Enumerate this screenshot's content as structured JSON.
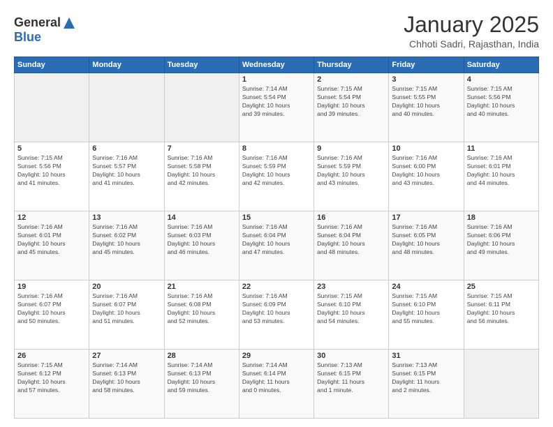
{
  "logo": {
    "general": "General",
    "blue": "Blue"
  },
  "header": {
    "month": "January 2025",
    "location": "Chhoti Sadri, Rajasthan, India"
  },
  "weekdays": [
    "Sunday",
    "Monday",
    "Tuesday",
    "Wednesday",
    "Thursday",
    "Friday",
    "Saturday"
  ],
  "weeks": [
    [
      {
        "day": "",
        "info": ""
      },
      {
        "day": "",
        "info": ""
      },
      {
        "day": "",
        "info": ""
      },
      {
        "day": "1",
        "info": "Sunrise: 7:14 AM\nSunset: 5:54 PM\nDaylight: 10 hours\nand 39 minutes."
      },
      {
        "day": "2",
        "info": "Sunrise: 7:15 AM\nSunset: 5:54 PM\nDaylight: 10 hours\nand 39 minutes."
      },
      {
        "day": "3",
        "info": "Sunrise: 7:15 AM\nSunset: 5:55 PM\nDaylight: 10 hours\nand 40 minutes."
      },
      {
        "day": "4",
        "info": "Sunrise: 7:15 AM\nSunset: 5:56 PM\nDaylight: 10 hours\nand 40 minutes."
      }
    ],
    [
      {
        "day": "5",
        "info": "Sunrise: 7:15 AM\nSunset: 5:56 PM\nDaylight: 10 hours\nand 41 minutes."
      },
      {
        "day": "6",
        "info": "Sunrise: 7:16 AM\nSunset: 5:57 PM\nDaylight: 10 hours\nand 41 minutes."
      },
      {
        "day": "7",
        "info": "Sunrise: 7:16 AM\nSunset: 5:58 PM\nDaylight: 10 hours\nand 42 minutes."
      },
      {
        "day": "8",
        "info": "Sunrise: 7:16 AM\nSunset: 5:59 PM\nDaylight: 10 hours\nand 42 minutes."
      },
      {
        "day": "9",
        "info": "Sunrise: 7:16 AM\nSunset: 5:59 PM\nDaylight: 10 hours\nand 43 minutes."
      },
      {
        "day": "10",
        "info": "Sunrise: 7:16 AM\nSunset: 6:00 PM\nDaylight: 10 hours\nand 43 minutes."
      },
      {
        "day": "11",
        "info": "Sunrise: 7:16 AM\nSunset: 6:01 PM\nDaylight: 10 hours\nand 44 minutes."
      }
    ],
    [
      {
        "day": "12",
        "info": "Sunrise: 7:16 AM\nSunset: 6:01 PM\nDaylight: 10 hours\nand 45 minutes."
      },
      {
        "day": "13",
        "info": "Sunrise: 7:16 AM\nSunset: 6:02 PM\nDaylight: 10 hours\nand 45 minutes."
      },
      {
        "day": "14",
        "info": "Sunrise: 7:16 AM\nSunset: 6:03 PM\nDaylight: 10 hours\nand 46 minutes."
      },
      {
        "day": "15",
        "info": "Sunrise: 7:16 AM\nSunset: 6:04 PM\nDaylight: 10 hours\nand 47 minutes."
      },
      {
        "day": "16",
        "info": "Sunrise: 7:16 AM\nSunset: 6:04 PM\nDaylight: 10 hours\nand 48 minutes."
      },
      {
        "day": "17",
        "info": "Sunrise: 7:16 AM\nSunset: 6:05 PM\nDaylight: 10 hours\nand 48 minutes."
      },
      {
        "day": "18",
        "info": "Sunrise: 7:16 AM\nSunset: 6:06 PM\nDaylight: 10 hours\nand 49 minutes."
      }
    ],
    [
      {
        "day": "19",
        "info": "Sunrise: 7:16 AM\nSunset: 6:07 PM\nDaylight: 10 hours\nand 50 minutes."
      },
      {
        "day": "20",
        "info": "Sunrise: 7:16 AM\nSunset: 6:07 PM\nDaylight: 10 hours\nand 51 minutes."
      },
      {
        "day": "21",
        "info": "Sunrise: 7:16 AM\nSunset: 6:08 PM\nDaylight: 10 hours\nand 52 minutes."
      },
      {
        "day": "22",
        "info": "Sunrise: 7:16 AM\nSunset: 6:09 PM\nDaylight: 10 hours\nand 53 minutes."
      },
      {
        "day": "23",
        "info": "Sunrise: 7:15 AM\nSunset: 6:10 PM\nDaylight: 10 hours\nand 54 minutes."
      },
      {
        "day": "24",
        "info": "Sunrise: 7:15 AM\nSunset: 6:10 PM\nDaylight: 10 hours\nand 55 minutes."
      },
      {
        "day": "25",
        "info": "Sunrise: 7:15 AM\nSunset: 6:11 PM\nDaylight: 10 hours\nand 56 minutes."
      }
    ],
    [
      {
        "day": "26",
        "info": "Sunrise: 7:15 AM\nSunset: 6:12 PM\nDaylight: 10 hours\nand 57 minutes."
      },
      {
        "day": "27",
        "info": "Sunrise: 7:14 AM\nSunset: 6:13 PM\nDaylight: 10 hours\nand 58 minutes."
      },
      {
        "day": "28",
        "info": "Sunrise: 7:14 AM\nSunset: 6:13 PM\nDaylight: 10 hours\nand 59 minutes."
      },
      {
        "day": "29",
        "info": "Sunrise: 7:14 AM\nSunset: 6:14 PM\nDaylight: 11 hours\nand 0 minutes."
      },
      {
        "day": "30",
        "info": "Sunrise: 7:13 AM\nSunset: 6:15 PM\nDaylight: 11 hours\nand 1 minute."
      },
      {
        "day": "31",
        "info": "Sunrise: 7:13 AM\nSunset: 6:15 PM\nDaylight: 11 hours\nand 2 minutes."
      },
      {
        "day": "",
        "info": ""
      }
    ]
  ]
}
